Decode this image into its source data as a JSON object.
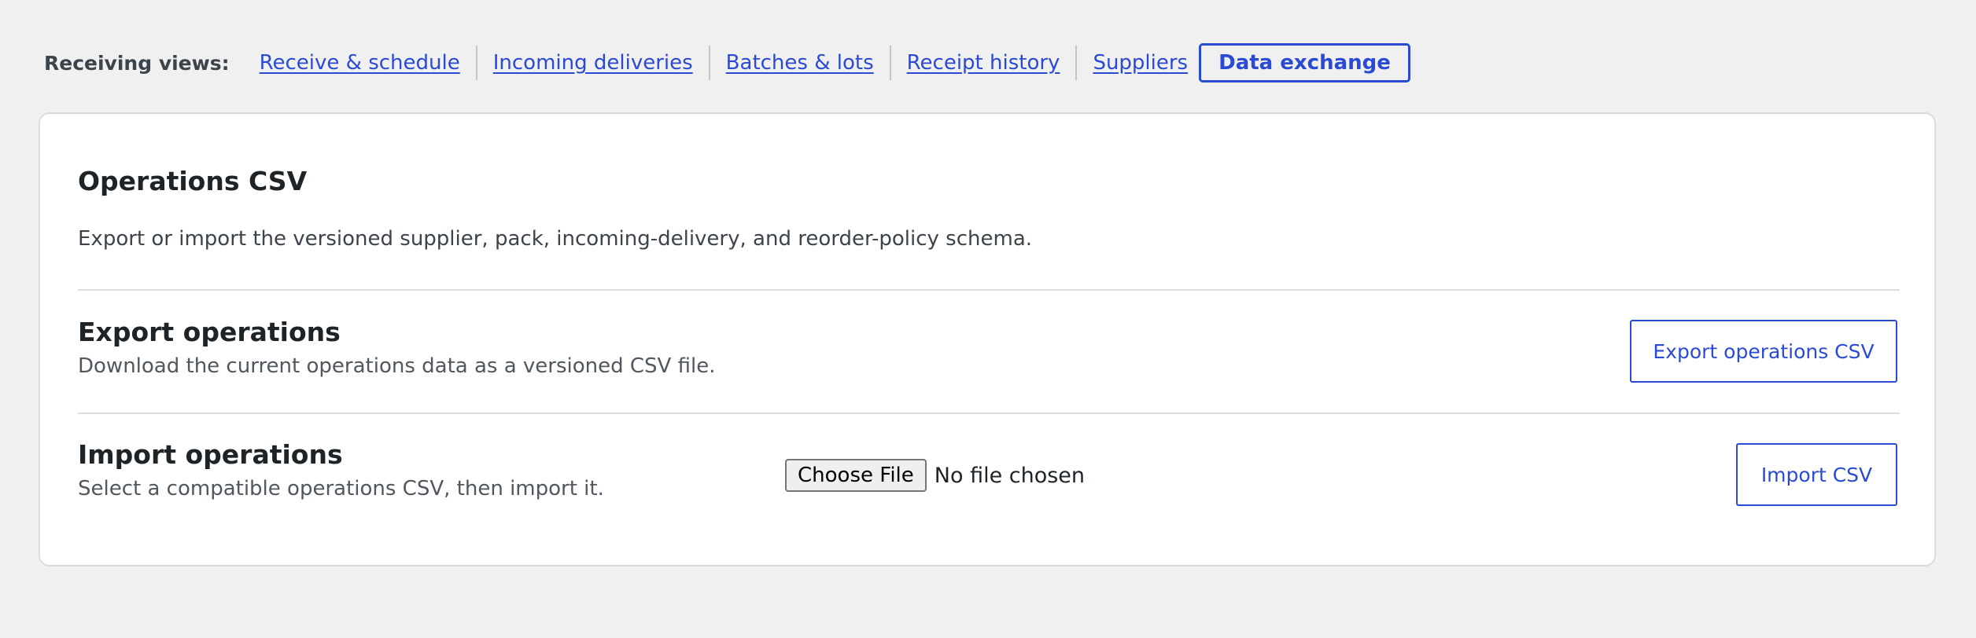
{
  "views_nav": {
    "label": "Receiving views:",
    "links": [
      {
        "label": "Receive & schedule"
      },
      {
        "label": "Incoming deliveries"
      },
      {
        "label": "Batches & lots"
      },
      {
        "label": "Receipt history"
      },
      {
        "label": "Suppliers"
      }
    ],
    "current": {
      "label": "Data exchange"
    }
  },
  "card": {
    "title": "Operations CSV",
    "description": "Export or import the versioned supplier, pack, incoming-delivery, and reorder-policy schema.",
    "export": {
      "title": "Export operations",
      "description": "Download the current operations data as a versioned CSV file.",
      "button_label": "Export operations CSV"
    },
    "import": {
      "title": "Import operations",
      "description": "Select a compatible operations CSV, then import it.",
      "choose_file_label": "Choose File",
      "file_status": "No file chosen",
      "button_label": "Import CSV"
    }
  },
  "colors": {
    "accent": "#2a4ad6",
    "background": "#f0f0f1",
    "card": "#ffffff"
  }
}
